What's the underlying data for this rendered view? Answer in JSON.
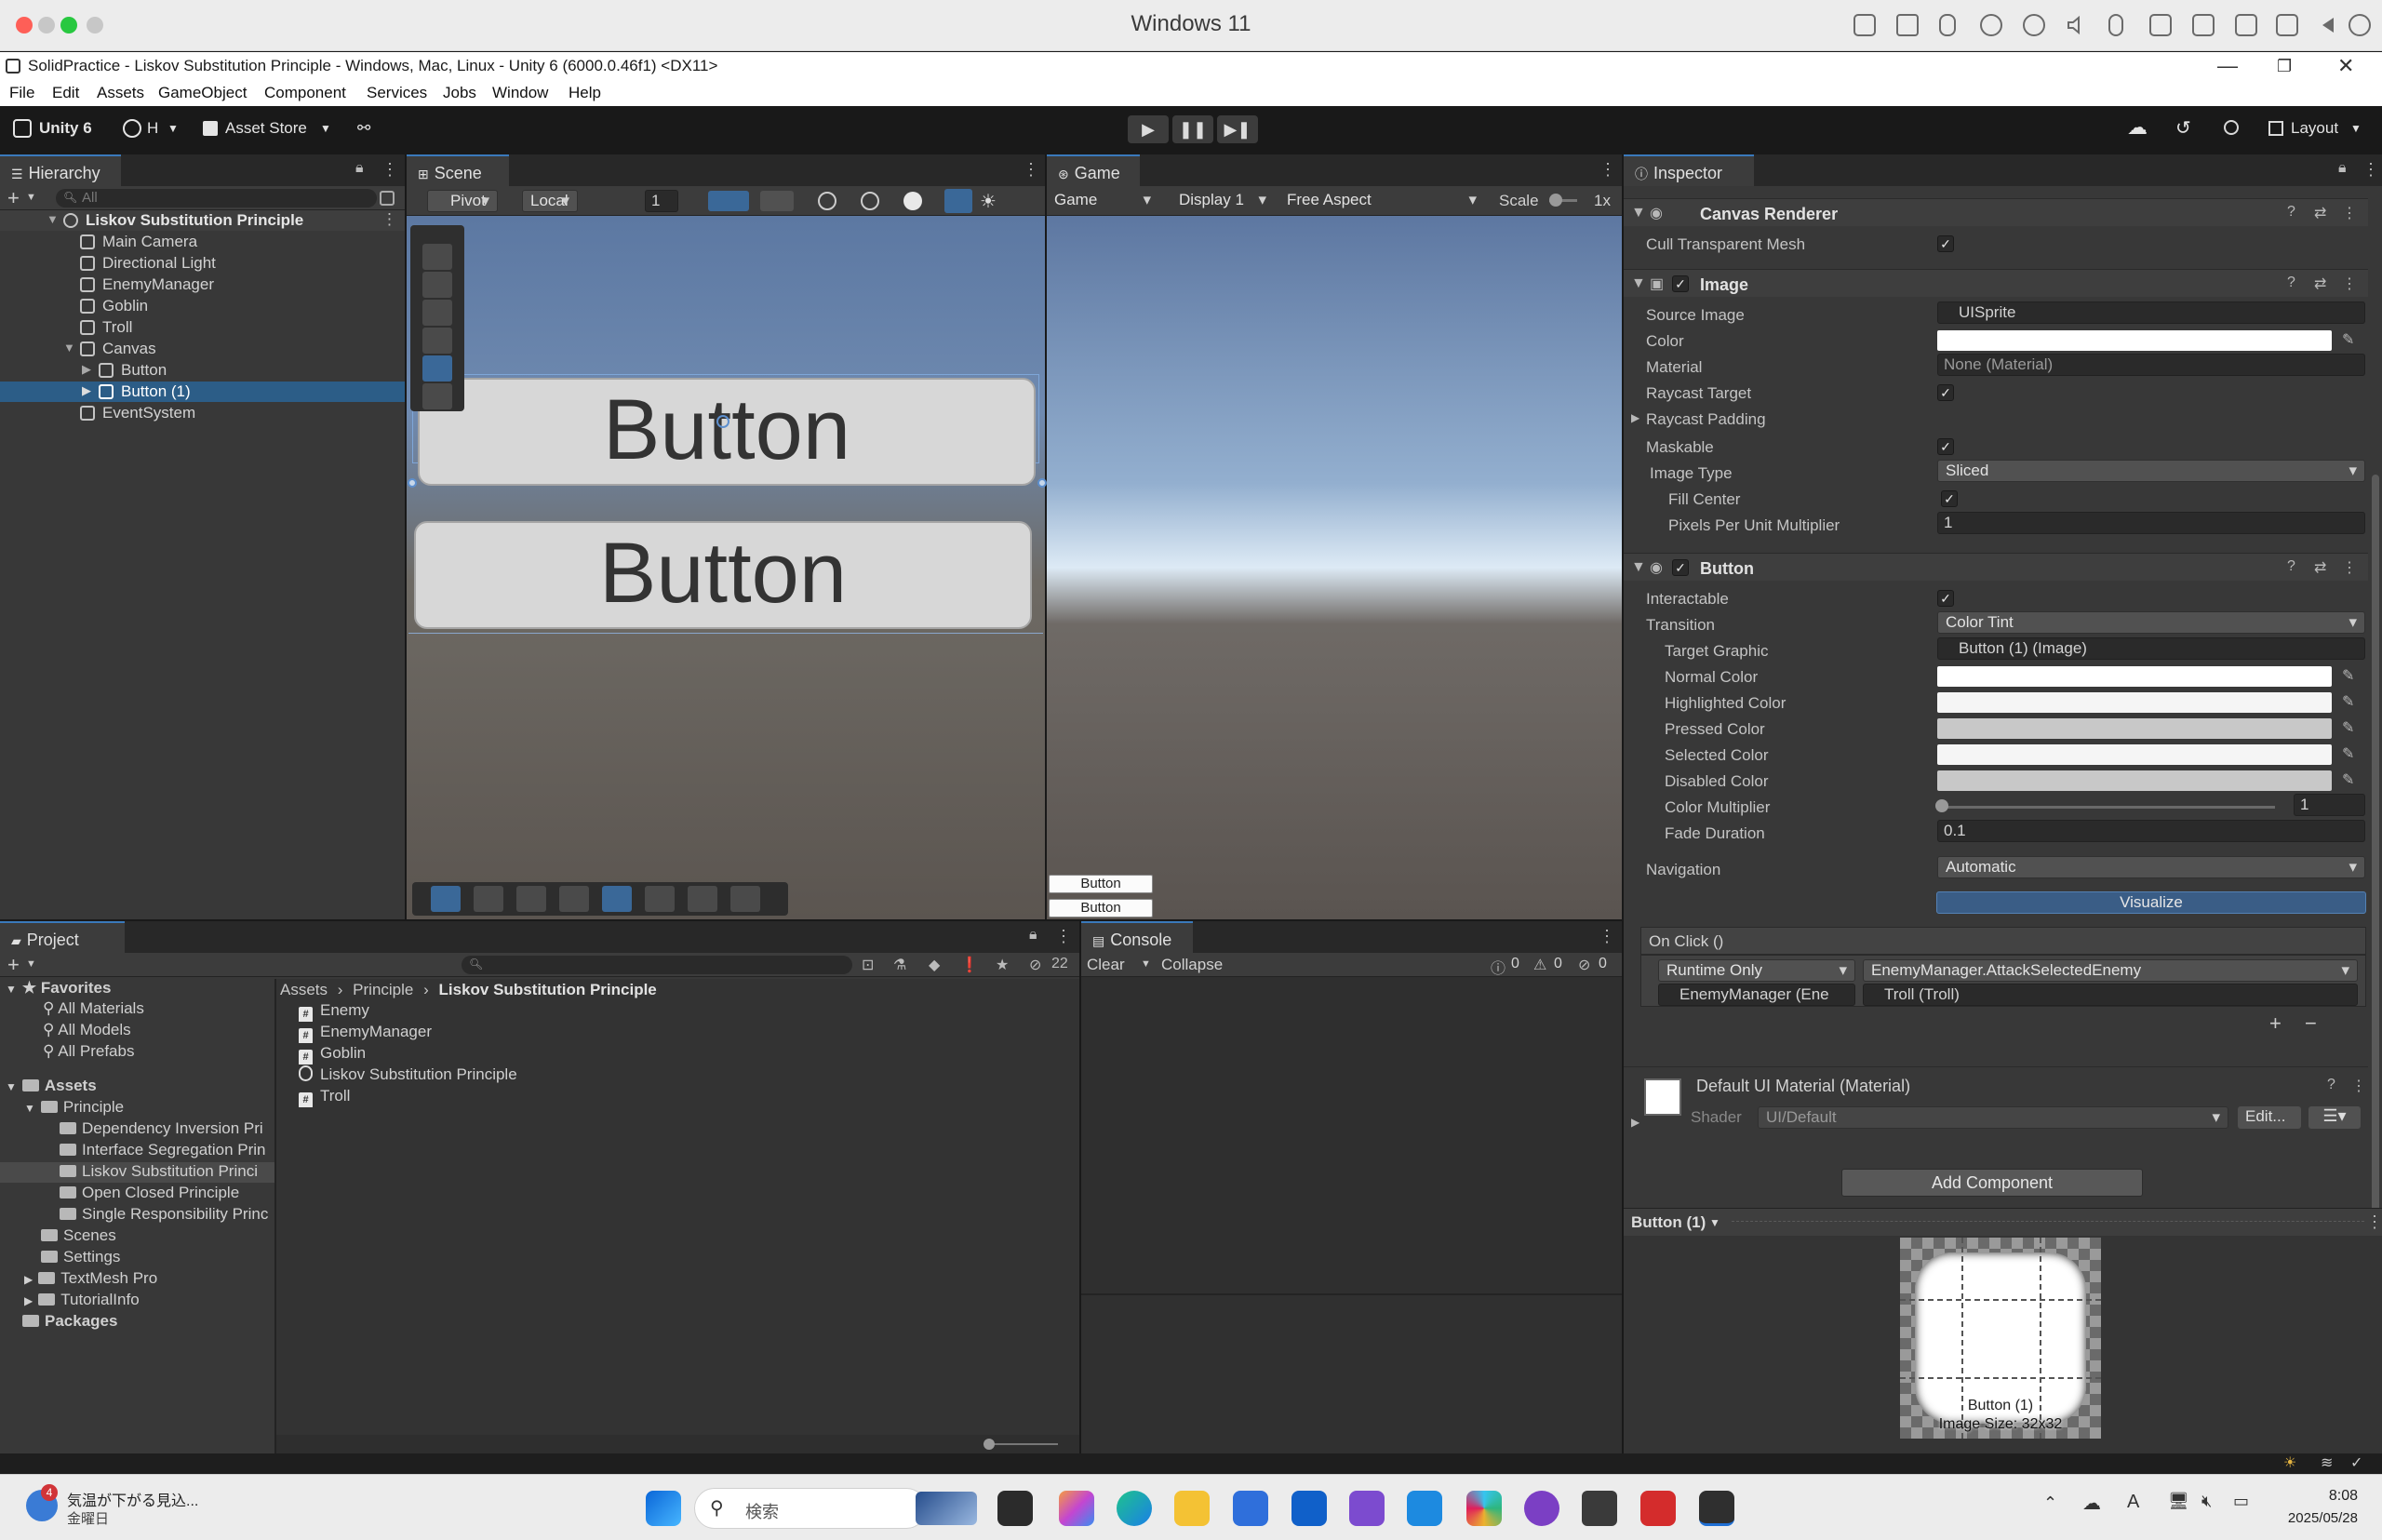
{
  "mac": {
    "title": "Windows 11"
  },
  "window": {
    "title": "SolidPractice - Liskov Substitution Principle - Windows, Mac, Linux - Unity 6 (6000.0.46f1) <DX11>"
  },
  "menu": [
    "File",
    "Edit",
    "Assets",
    "GameObject",
    "Component",
    "Services",
    "Jobs",
    "Window",
    "Help"
  ],
  "toolbar": {
    "app": "Unity 6",
    "account": "H",
    "asset_store": "Asset Store",
    "layout": "Layout"
  },
  "hierarchy": {
    "tab": "Hierarchy",
    "search_placeholder": "All",
    "items": [
      {
        "label": "Liskov Substitution Principle",
        "depth": 0,
        "scene": true
      },
      {
        "label": "Main Camera",
        "depth": 1
      },
      {
        "label": "Directional Light",
        "depth": 1
      },
      {
        "label": "EnemyManager",
        "depth": 1
      },
      {
        "label": "Goblin",
        "depth": 1
      },
      {
        "label": "Troll",
        "depth": 1
      },
      {
        "label": "Canvas",
        "depth": 1,
        "expanded": true
      },
      {
        "label": "Button",
        "depth": 2,
        "collapsed": true
      },
      {
        "label": "Button (1)",
        "depth": 2,
        "collapsed": true,
        "selected": true
      },
      {
        "label": "EventSystem",
        "depth": 1
      }
    ]
  },
  "scene": {
    "tab": "Scene",
    "pivot": "Pivot",
    "local": "Local",
    "grid_value": "1",
    "button_text_1": "Button",
    "button_text_2": "Button"
  },
  "game": {
    "tab": "Game",
    "mode": "Game",
    "display": "Display 1",
    "aspect": "Free Aspect",
    "scale_label": "Scale",
    "scale_value": "1x",
    "button_1": "Button",
    "button_2": "Button"
  },
  "inspector": {
    "tab": "Inspector",
    "canvas_renderer": {
      "title": "Canvas Renderer",
      "cull_label": "Cull Transparent Mesh"
    },
    "image": {
      "title": "Image",
      "source_image_label": "Source Image",
      "source_image": "UISprite",
      "color_label": "Color",
      "material_label": "Material",
      "material": "None (Material)",
      "raycast_target_label": "Raycast Target",
      "raycast_padding_label": "Raycast Padding",
      "maskable_label": "Maskable",
      "image_type_label": "Image Type",
      "image_type": "Sliced",
      "fill_center_label": "Fill Center",
      "ppu_label": "Pixels Per Unit Multiplier",
      "ppu": "1"
    },
    "button": {
      "title": "Button",
      "interactable_label": "Interactable",
      "transition_label": "Transition",
      "transition": "Color Tint",
      "target_graphic_label": "Target Graphic",
      "target_graphic": "Button (1) (Image)",
      "normal_label": "Normal Color",
      "highlighted_label": "Highlighted Color",
      "pressed_label": "Pressed Color",
      "selected_label": "Selected Color",
      "disabled_label": "Disabled Color",
      "multiplier_label": "Color Multiplier",
      "multiplier": "1",
      "fade_label": "Fade Duration",
      "fade": "0.1",
      "navigation_label": "Navigation",
      "navigation": "Automatic",
      "visualize": "Visualize",
      "onclick_label": "On Click ()",
      "runtime": "Runtime Only",
      "function": "EnemyManager.AttackSelectedEnemy",
      "object": "EnemyManager (Ene",
      "argument": "Troll (Troll)"
    },
    "material": {
      "title": "Default UI Material (Material)",
      "shader_label": "Shader",
      "shader": "UI/Default",
      "edit": "Edit..."
    },
    "add_component": "Add Component",
    "preview": {
      "title": "Button (1)",
      "name": "Button (1)",
      "size": "Image Size: 32x32"
    },
    "colors": {
      "normal": "#ffffff",
      "highlighted": "#f5f5f5",
      "pressed": "#c8c8c8",
      "selected": "#f5f5f5",
      "disabled": "#c8c8c8"
    }
  },
  "project": {
    "tab": "Project",
    "hidden_count": "22",
    "favorites_label": "Favorites",
    "favorites": [
      "All Materials",
      "All Models",
      "All Prefabs"
    ],
    "assets_label": "Assets",
    "principle_label": "Principle",
    "principle_children": [
      "Dependency Inversion Pri",
      "Interface Segregation Prin",
      "Liskov Substitution Princi",
      "Open Closed Principle",
      "Single Responsibility Princ"
    ],
    "asset_folders": [
      "Scenes",
      "Settings",
      "TextMesh Pro",
      "TutorialInfo"
    ],
    "packages_label": "Packages",
    "breadcrumb": [
      "Assets",
      "Principle",
      "Liskov Substitution Principle"
    ],
    "files": [
      {
        "name": "Enemy",
        "type": "script"
      },
      {
        "name": "EnemyManager",
        "type": "script"
      },
      {
        "name": "Goblin",
        "type": "script"
      },
      {
        "name": "Liskov Substitution Principle",
        "type": "scene"
      },
      {
        "name": "Troll",
        "type": "script"
      }
    ]
  },
  "console": {
    "tab": "Console",
    "clear": "Clear",
    "collapse": "Collapse",
    "logs": "0",
    "warnings": "0",
    "errors": "0"
  },
  "taskbar": {
    "weather_badge": "4",
    "weather_line1": "気温が下がる見込...",
    "weather_line2": "金曜日",
    "search": "検索",
    "time": "8:08",
    "date": "2025/05/28"
  }
}
